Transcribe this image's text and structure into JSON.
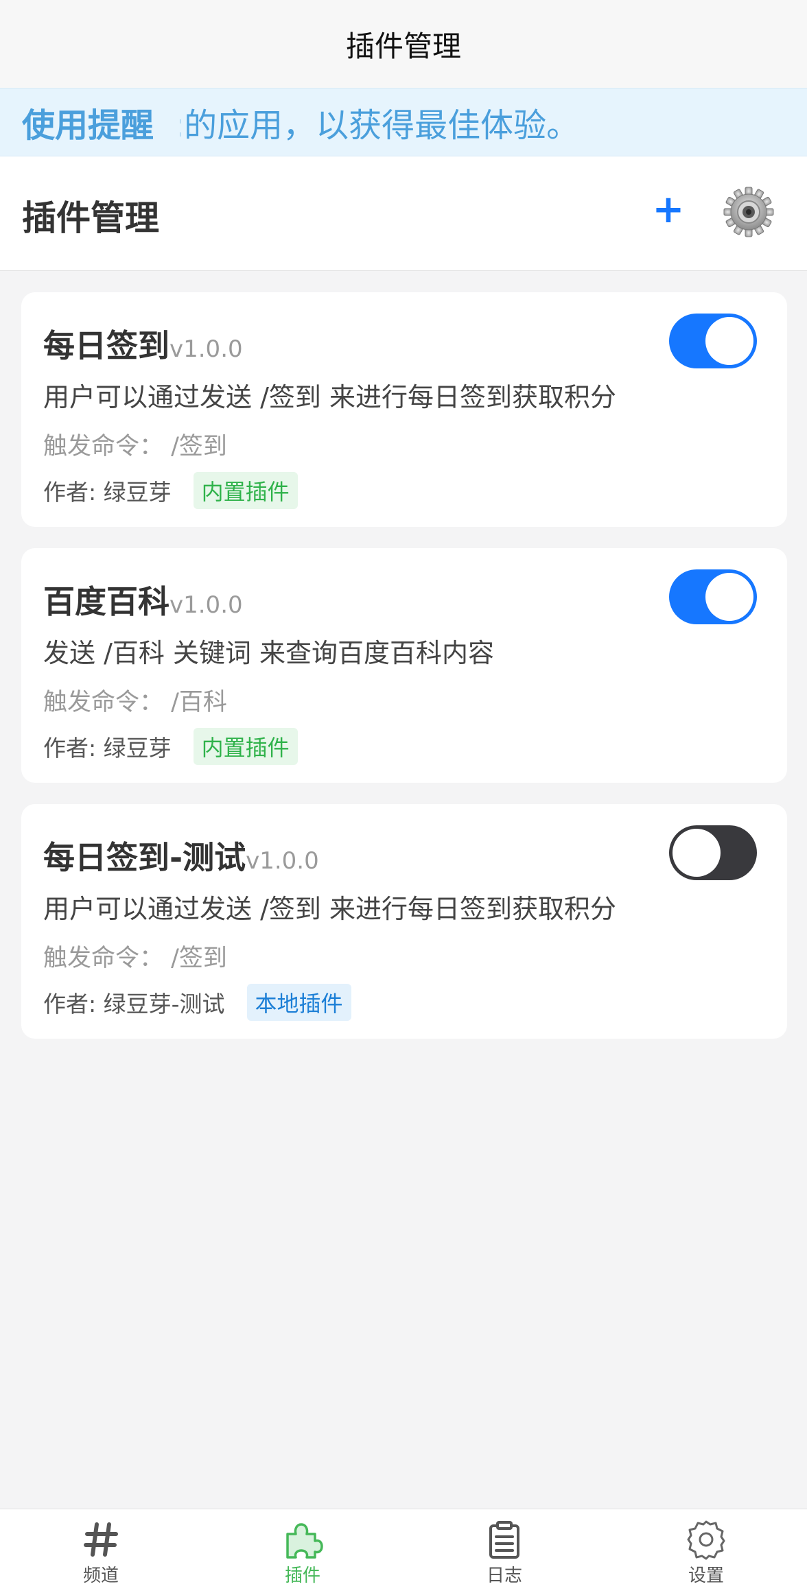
{
  "nav": {
    "title": "插件管理"
  },
  "notice": {
    "label": "使用提醒",
    "text": ":的应用，以获得最佳体验。"
  },
  "header": {
    "title": "插件管理",
    "add_label": "+"
  },
  "plugins": [
    {
      "name": "每日签到",
      "version": "v1.0.0",
      "description": "用户可以通过发送 /签到 来进行每日签到获取积分",
      "trigger": "触发命令：  /签到",
      "author": "作者: 绿豆芽",
      "tag": "内置插件",
      "enabled": true
    },
    {
      "name": "百度百科",
      "version": "v1.0.0",
      "description": "发送 /百科 关键词 来查询百度百科内容",
      "trigger": "触发命令：  /百科",
      "author": "作者: 绿豆芽",
      "tag": "内置插件",
      "enabled": true
    },
    {
      "name": "每日签到-测试",
      "version": "v1.0.0",
      "description": "用户可以通过发送 /签到 来进行每日签到获取积分",
      "trigger": "触发命令：  /签到",
      "author": "作者: 绿豆芽-测试",
      "tag": "本地插件",
      "enabled": false
    }
  ],
  "tabbar": {
    "items": [
      {
        "label": "频道",
        "icon": "hash-icon",
        "active": false
      },
      {
        "label": "插件",
        "icon": "puzzle-icon",
        "active": true
      },
      {
        "label": "日志",
        "icon": "clipboard-icon",
        "active": false
      },
      {
        "label": "设置",
        "icon": "gear-icon",
        "active": false
      }
    ]
  },
  "colors": {
    "accent": "#1677ff",
    "active_tab": "#45b858",
    "notice_text": "#4a9fdc",
    "toggle_off": "#39393d"
  }
}
